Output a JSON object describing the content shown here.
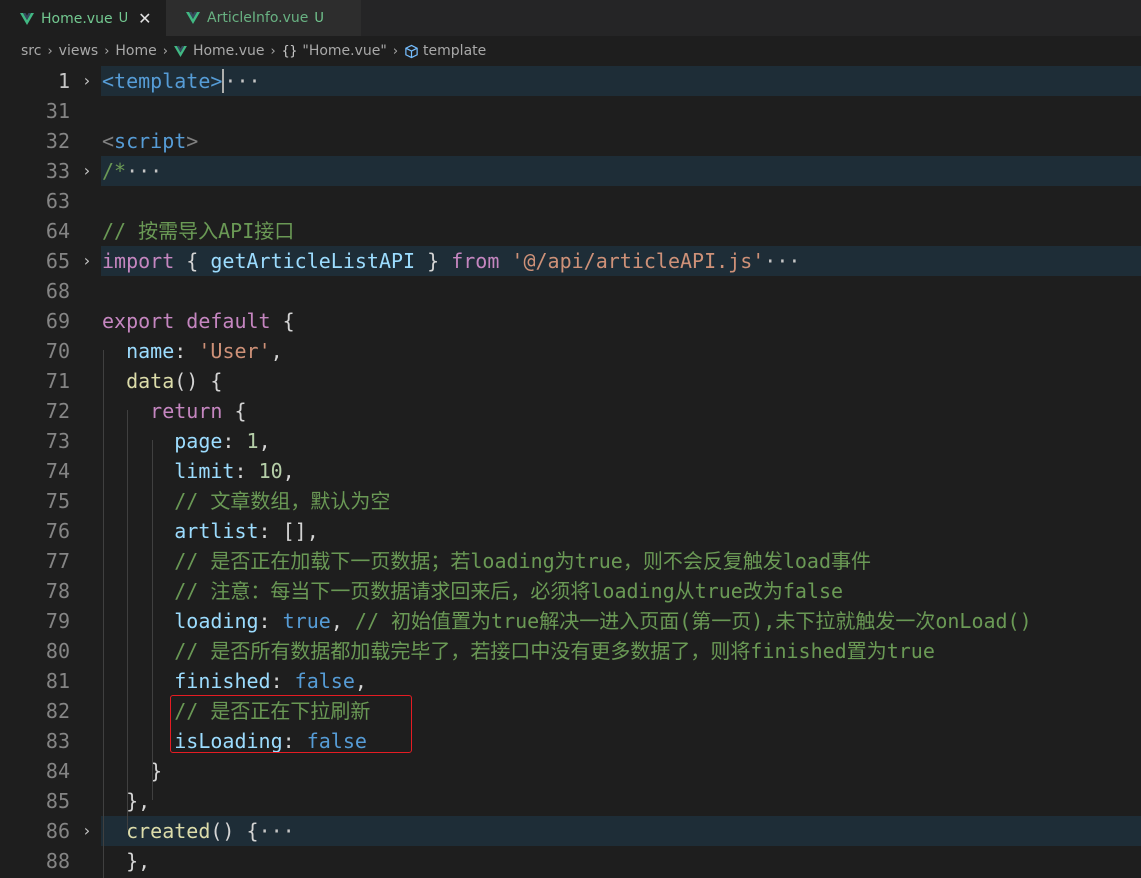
{
  "tabs": [
    {
      "name": "Home.vue",
      "status": "U",
      "close": "✕"
    },
    {
      "name": "ArticleInfo.vue",
      "status": "U"
    }
  ],
  "breadcrumb": {
    "items": [
      "src",
      "views",
      "Home",
      "Home.vue",
      "\"Home.vue\"",
      "template"
    ],
    "separator": "›"
  },
  "colors": {
    "comment": "#6a9955",
    "keyword": "#c586c0",
    "blue": "#569cd6",
    "property": "#9cdcfe",
    "function": "#dcdcaa",
    "string": "#ce9178",
    "number": "#b5cea8",
    "tab_text": "#73c991",
    "highlight_box": "#e51c23"
  },
  "editor": {
    "lines": [
      {
        "n": "1",
        "fold": "›",
        "parts": [
          [
            "t-tag",
            "<template>"
          ],
          [
            "t-fold",
            "···"
          ]
        ]
      },
      {
        "n": "31",
        "parts": []
      },
      {
        "n": "32",
        "parts": [
          [
            "t-br",
            "<"
          ],
          [
            "t-tag",
            "script"
          ],
          [
            "t-br",
            ">"
          ]
        ]
      },
      {
        "n": "33",
        "fold": "›",
        "parts": [
          [
            "t-cmt",
            "/*"
          ],
          [
            "t-fold",
            "···"
          ]
        ]
      },
      {
        "n": "63",
        "parts": []
      },
      {
        "n": "64",
        "parts": [
          [
            "t-cmt",
            "// 按需导入API接口"
          ]
        ]
      },
      {
        "n": "65",
        "fold": "›",
        "parts": [
          [
            "t-kw",
            "import"
          ],
          [
            "t-plain",
            " { "
          ],
          [
            "t-prop",
            "getArticleListAPI"
          ],
          [
            "t-plain",
            " } "
          ],
          [
            "t-kw",
            "from"
          ],
          [
            "t-plain",
            " "
          ],
          [
            "t-str",
            "'@/api/articleAPI.js'"
          ],
          [
            "t-fold",
            "···"
          ]
        ]
      },
      {
        "n": "68",
        "parts": []
      },
      {
        "n": "69",
        "parts": [
          [
            "t-kw",
            "export"
          ],
          [
            "t-plain",
            " "
          ],
          [
            "t-kw",
            "default"
          ],
          [
            "t-plain",
            " {"
          ]
        ]
      },
      {
        "n": "70",
        "parts": [
          [
            "t-plain",
            "  "
          ],
          [
            "t-prop",
            "name"
          ],
          [
            "t-plain",
            ": "
          ],
          [
            "t-str",
            "'User'"
          ],
          [
            "t-plain",
            ","
          ]
        ]
      },
      {
        "n": "71",
        "parts": [
          [
            "t-plain",
            "  "
          ],
          [
            "t-fn",
            "data"
          ],
          [
            "t-plain",
            "() {"
          ]
        ]
      },
      {
        "n": "72",
        "parts": [
          [
            "t-plain",
            "    "
          ],
          [
            "t-kw",
            "return"
          ],
          [
            "t-plain",
            " {"
          ]
        ]
      },
      {
        "n": "73",
        "parts": [
          [
            "t-plain",
            "      "
          ],
          [
            "t-prop",
            "page"
          ],
          [
            "t-plain",
            ": "
          ],
          [
            "t-num",
            "1"
          ],
          [
            "t-plain",
            ","
          ]
        ]
      },
      {
        "n": "74",
        "parts": [
          [
            "t-plain",
            "      "
          ],
          [
            "t-prop",
            "limit"
          ],
          [
            "t-plain",
            ": "
          ],
          [
            "t-num",
            "10"
          ],
          [
            "t-plain",
            ","
          ]
        ]
      },
      {
        "n": "75",
        "parts": [
          [
            "t-plain",
            "      "
          ],
          [
            "t-cmt",
            "// 文章数组，默认为空"
          ]
        ]
      },
      {
        "n": "76",
        "parts": [
          [
            "t-plain",
            "      "
          ],
          [
            "t-prop",
            "artlist"
          ],
          [
            "t-plain",
            ": [],"
          ]
        ]
      },
      {
        "n": "77",
        "parts": [
          [
            "t-plain",
            "      "
          ],
          [
            "t-cmt",
            "// 是否正在加载下一页数据；若loading为true，则不会反复触发load事件"
          ]
        ]
      },
      {
        "n": "78",
        "parts": [
          [
            "t-plain",
            "      "
          ],
          [
            "t-cmt",
            "// 注意：每当下一页数据请求回来后，必须将loading从true改为false"
          ]
        ]
      },
      {
        "n": "79",
        "parts": [
          [
            "t-plain",
            "      "
          ],
          [
            "t-prop",
            "loading"
          ],
          [
            "t-plain",
            ": "
          ],
          [
            "t-blue",
            "true"
          ],
          [
            "t-plain",
            ", "
          ],
          [
            "t-cmt",
            "// 初始值置为true解决一进入页面(第一页),未下拉就触发一次onLoad()"
          ]
        ]
      },
      {
        "n": "80",
        "parts": [
          [
            "t-plain",
            "      "
          ],
          [
            "t-cmt",
            "// 是否所有数据都加载完毕了，若接口中没有更多数据了，则将finished置为true"
          ]
        ]
      },
      {
        "n": "81",
        "parts": [
          [
            "t-plain",
            "      "
          ],
          [
            "t-prop",
            "finished"
          ],
          [
            "t-plain",
            ": "
          ],
          [
            "t-blue",
            "false"
          ],
          [
            "t-plain",
            ","
          ]
        ]
      },
      {
        "n": "82",
        "parts": [
          [
            "t-plain",
            "      "
          ],
          [
            "t-cmt",
            "// 是否正在下拉刷新"
          ]
        ]
      },
      {
        "n": "83",
        "parts": [
          [
            "t-plain",
            "      "
          ],
          [
            "t-prop",
            "isLoading"
          ],
          [
            "t-plain",
            ": "
          ],
          [
            "t-blue",
            "false"
          ]
        ]
      },
      {
        "n": "84",
        "parts": [
          [
            "t-plain",
            "    }"
          ]
        ]
      },
      {
        "n": "85",
        "parts": [
          [
            "t-plain",
            "  },"
          ]
        ]
      },
      {
        "n": "86",
        "fold": "›",
        "parts": [
          [
            "t-plain",
            "  "
          ],
          [
            "t-fn",
            "created"
          ],
          [
            "t-plain",
            "() {"
          ],
          [
            "t-fold",
            "···"
          ]
        ]
      },
      {
        "n": "88",
        "parts": [
          [
            "t-plain",
            "  },"
          ]
        ]
      }
    ]
  }
}
